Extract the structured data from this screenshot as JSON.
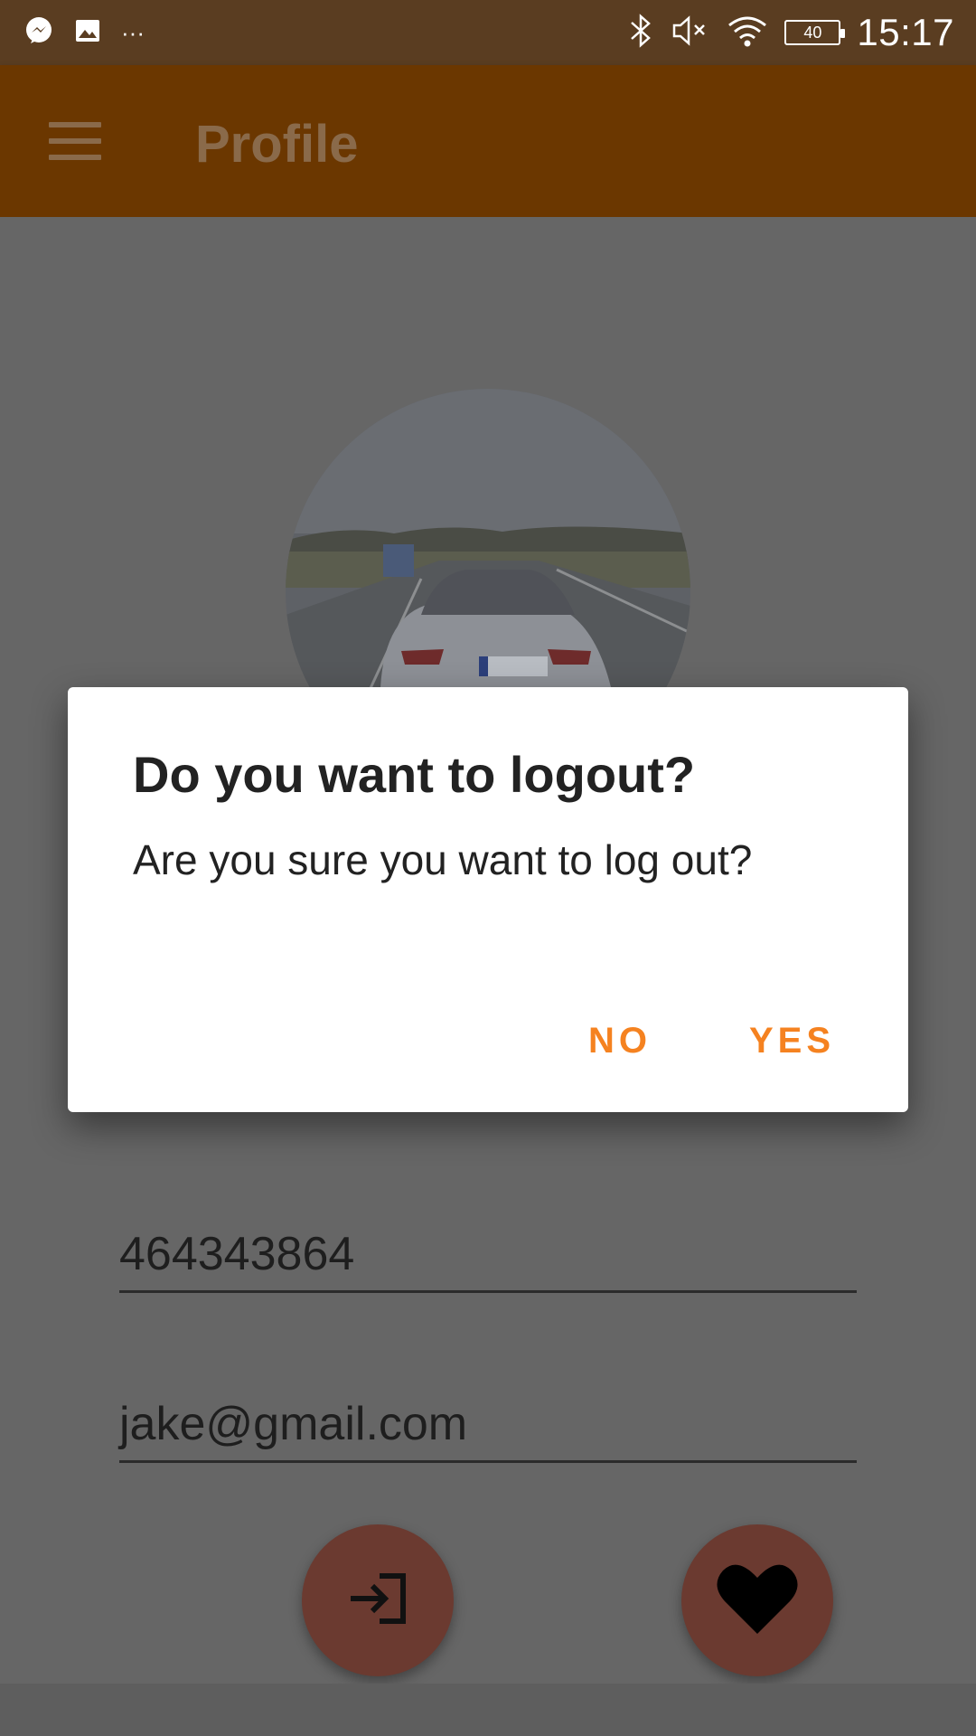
{
  "status_bar": {
    "time": "15:17",
    "battery_level": "40",
    "overflow_dots": "···",
    "left_icons": [
      "messenger-icon",
      "gallery-icon"
    ],
    "right_icons": [
      "bluetooth-icon",
      "mute-icon",
      "wifi-icon",
      "battery-icon"
    ]
  },
  "app_bar": {
    "title": "Profile",
    "menu_icon": "hamburger-menu-icon"
  },
  "profile": {
    "avatar_description": "car-photo",
    "phone": "464343864",
    "email": "jake@gmail.com"
  },
  "fabs": {
    "left_icon": "login-icon",
    "right_icon": "heart-icon"
  },
  "dialog": {
    "title": "Do you want to logout?",
    "message": "Are you sure you want to log out?",
    "negative_label": "NO",
    "positive_label": "YES"
  },
  "colors": {
    "status_bar": "#5a3d21",
    "app_bar": "#6b3700",
    "accent": "#f58220",
    "fab": "#6b3a30",
    "scrim_background": "#666666"
  }
}
